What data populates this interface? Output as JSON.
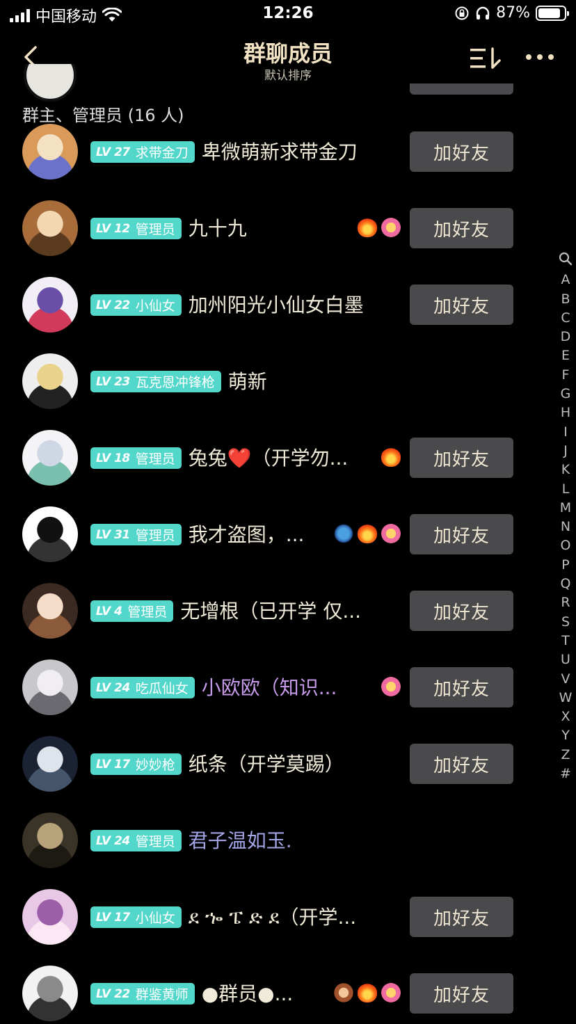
{
  "status": {
    "carrier": "中国移动",
    "time": "12:26",
    "battery": "87%",
    "battery_level": 0.87
  },
  "nav": {
    "title": "群聊成员",
    "subtitle": "默认排序"
  },
  "section": {
    "header": "群主、管理员 (16 人)"
  },
  "add_label": "加好友",
  "members": [
    {
      "lv": "LV 27",
      "badge": "求带金刀",
      "name": "卑微萌新求带金刀",
      "color": "normal",
      "emojis": [],
      "button": true,
      "avatar": [
        "#d99a5a",
        "#f4e0c2",
        "#6b72c9"
      ]
    },
    {
      "lv": "LV 12",
      "badge": "管理员",
      "name": "九十九",
      "color": "normal",
      "emojis": [
        "fire",
        "flower"
      ],
      "button": true,
      "avatar": [
        "#a86d3a",
        "#f2d7b0",
        "#5b3b20"
      ]
    },
    {
      "lv": "LV 22",
      "badge": "小仙女",
      "name": "加州阳光小仙女白墨",
      "color": "normal",
      "emojis": [],
      "button": true,
      "avatar": [
        "#f2eef5",
        "#6a4fa8",
        "#d13a5a"
      ]
    },
    {
      "lv": "LV 23",
      "badge": "瓦克恩冲锋枪",
      "name": "萌新",
      "color": "normal",
      "emojis": [],
      "button": false,
      "avatar": [
        "#eeeeee",
        "#e9d38a",
        "#222222"
      ]
    },
    {
      "lv": "LV 18",
      "badge": "管理员",
      "name": "兔兔❤️（开学勿...",
      "color": "normal",
      "emojis": [
        "fire"
      ],
      "button": true,
      "avatar": [
        "#f4f4f6",
        "#cfd6e4",
        "#7bbfae"
      ]
    },
    {
      "lv": "LV 31",
      "badge": "管理员",
      "name": "我才盗图，...",
      "color": "normal",
      "emojis": [
        "dragon",
        "fire",
        "flower"
      ],
      "button": true,
      "avatar": [
        "#ffffff",
        "#111111",
        "#333333"
      ]
    },
    {
      "lv": "LV 4",
      "badge": "管理员",
      "name": "无增根（已开学 仅...",
      "color": "normal",
      "emojis": [],
      "button": true,
      "avatar": [
        "#3a2a22",
        "#f5dcc8",
        "#8a5a3a"
      ]
    },
    {
      "lv": "LV 24",
      "badge": "吃瓜仙女",
      "name": "小欧欧（知识...",
      "color": "purple",
      "emojis": [
        "flower"
      ],
      "button": true,
      "avatar": [
        "#c8c8cc",
        "#f0eef0",
        "#6a6a70"
      ]
    },
    {
      "lv": "LV 17",
      "badge": "妙妙枪",
      "name": "纸条（开学莫踢）",
      "color": "normal",
      "emojis": [],
      "button": true,
      "avatar": [
        "#1a2233",
        "#dfe4ec",
        "#44556b"
      ]
    },
    {
      "lv": "LV 24",
      "badge": "管理员",
      "name": "君子温如玉.",
      "color": "blue",
      "emojis": [],
      "button": false,
      "avatar": [
        "#3a3428",
        "#b8a27a",
        "#1d1a14"
      ]
    },
    {
      "lv": "LV 17",
      "badge": "小仙女",
      "name": "ደ ኈ ፔ ድ ደ（开学...",
      "color": "normal",
      "emojis": [],
      "button": true,
      "avatar": [
        "#e9c7e6",
        "#9b5ea8",
        "#fbe8f4"
      ]
    },
    {
      "lv": "LV 22",
      "badge": "群鉴黄师",
      "name": "●群员●...",
      "color": "normal",
      "emojis": [
        "monkey",
        "fire",
        "flower"
      ],
      "button": true,
      "avatar": [
        "#f2f2f2",
        "#8a8a8a",
        "#333333"
      ]
    }
  ],
  "index_letters": [
    "🔍",
    "A",
    "B",
    "C",
    "D",
    "E",
    "F",
    "G",
    "H",
    "I",
    "J",
    "K",
    "L",
    "M",
    "N",
    "O",
    "P",
    "Q",
    "R",
    "S",
    "T",
    "U",
    "V",
    "W",
    "X",
    "Y",
    "Z",
    "#"
  ]
}
